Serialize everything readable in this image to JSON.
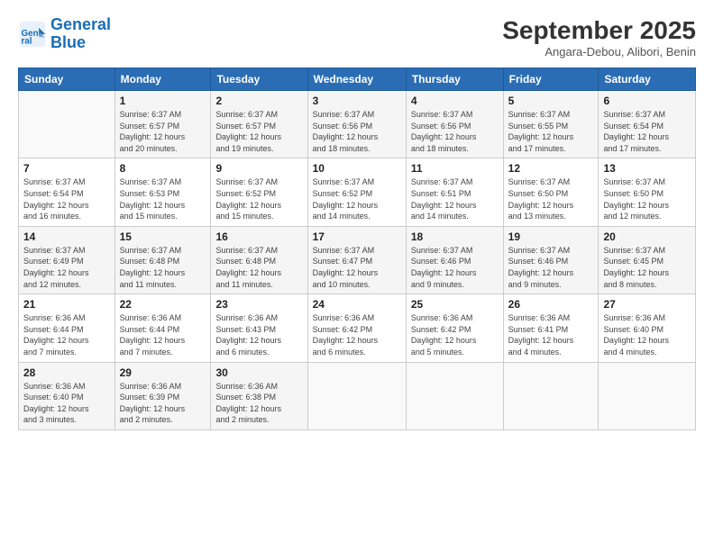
{
  "header": {
    "logo_line1": "General",
    "logo_line2": "Blue",
    "month_year": "September 2025",
    "location": "Angara-Debou, Alibori, Benin"
  },
  "days_of_week": [
    "Sunday",
    "Monday",
    "Tuesday",
    "Wednesday",
    "Thursday",
    "Friday",
    "Saturday"
  ],
  "weeks": [
    [
      {
        "day": "",
        "info": ""
      },
      {
        "day": "1",
        "info": "Sunrise: 6:37 AM\nSunset: 6:57 PM\nDaylight: 12 hours\nand 20 minutes."
      },
      {
        "day": "2",
        "info": "Sunrise: 6:37 AM\nSunset: 6:57 PM\nDaylight: 12 hours\nand 19 minutes."
      },
      {
        "day": "3",
        "info": "Sunrise: 6:37 AM\nSunset: 6:56 PM\nDaylight: 12 hours\nand 18 minutes."
      },
      {
        "day": "4",
        "info": "Sunrise: 6:37 AM\nSunset: 6:56 PM\nDaylight: 12 hours\nand 18 minutes."
      },
      {
        "day": "5",
        "info": "Sunrise: 6:37 AM\nSunset: 6:55 PM\nDaylight: 12 hours\nand 17 minutes."
      },
      {
        "day": "6",
        "info": "Sunrise: 6:37 AM\nSunset: 6:54 PM\nDaylight: 12 hours\nand 17 minutes."
      }
    ],
    [
      {
        "day": "7",
        "info": "Sunrise: 6:37 AM\nSunset: 6:54 PM\nDaylight: 12 hours\nand 16 minutes."
      },
      {
        "day": "8",
        "info": "Sunrise: 6:37 AM\nSunset: 6:53 PM\nDaylight: 12 hours\nand 15 minutes."
      },
      {
        "day": "9",
        "info": "Sunrise: 6:37 AM\nSunset: 6:52 PM\nDaylight: 12 hours\nand 15 minutes."
      },
      {
        "day": "10",
        "info": "Sunrise: 6:37 AM\nSunset: 6:52 PM\nDaylight: 12 hours\nand 14 minutes."
      },
      {
        "day": "11",
        "info": "Sunrise: 6:37 AM\nSunset: 6:51 PM\nDaylight: 12 hours\nand 14 minutes."
      },
      {
        "day": "12",
        "info": "Sunrise: 6:37 AM\nSunset: 6:50 PM\nDaylight: 12 hours\nand 13 minutes."
      },
      {
        "day": "13",
        "info": "Sunrise: 6:37 AM\nSunset: 6:50 PM\nDaylight: 12 hours\nand 12 minutes."
      }
    ],
    [
      {
        "day": "14",
        "info": "Sunrise: 6:37 AM\nSunset: 6:49 PM\nDaylight: 12 hours\nand 12 minutes."
      },
      {
        "day": "15",
        "info": "Sunrise: 6:37 AM\nSunset: 6:48 PM\nDaylight: 12 hours\nand 11 minutes."
      },
      {
        "day": "16",
        "info": "Sunrise: 6:37 AM\nSunset: 6:48 PM\nDaylight: 12 hours\nand 11 minutes."
      },
      {
        "day": "17",
        "info": "Sunrise: 6:37 AM\nSunset: 6:47 PM\nDaylight: 12 hours\nand 10 minutes."
      },
      {
        "day": "18",
        "info": "Sunrise: 6:37 AM\nSunset: 6:46 PM\nDaylight: 12 hours\nand 9 minutes."
      },
      {
        "day": "19",
        "info": "Sunrise: 6:37 AM\nSunset: 6:46 PM\nDaylight: 12 hours\nand 9 minutes."
      },
      {
        "day": "20",
        "info": "Sunrise: 6:37 AM\nSunset: 6:45 PM\nDaylight: 12 hours\nand 8 minutes."
      }
    ],
    [
      {
        "day": "21",
        "info": "Sunrise: 6:36 AM\nSunset: 6:44 PM\nDaylight: 12 hours\nand 7 minutes."
      },
      {
        "day": "22",
        "info": "Sunrise: 6:36 AM\nSunset: 6:44 PM\nDaylight: 12 hours\nand 7 minutes."
      },
      {
        "day": "23",
        "info": "Sunrise: 6:36 AM\nSunset: 6:43 PM\nDaylight: 12 hours\nand 6 minutes."
      },
      {
        "day": "24",
        "info": "Sunrise: 6:36 AM\nSunset: 6:42 PM\nDaylight: 12 hours\nand 6 minutes."
      },
      {
        "day": "25",
        "info": "Sunrise: 6:36 AM\nSunset: 6:42 PM\nDaylight: 12 hours\nand 5 minutes."
      },
      {
        "day": "26",
        "info": "Sunrise: 6:36 AM\nSunset: 6:41 PM\nDaylight: 12 hours\nand 4 minutes."
      },
      {
        "day": "27",
        "info": "Sunrise: 6:36 AM\nSunset: 6:40 PM\nDaylight: 12 hours\nand 4 minutes."
      }
    ],
    [
      {
        "day": "28",
        "info": "Sunrise: 6:36 AM\nSunset: 6:40 PM\nDaylight: 12 hours\nand 3 minutes."
      },
      {
        "day": "29",
        "info": "Sunrise: 6:36 AM\nSunset: 6:39 PM\nDaylight: 12 hours\nand 2 minutes."
      },
      {
        "day": "30",
        "info": "Sunrise: 6:36 AM\nSunset: 6:38 PM\nDaylight: 12 hours\nand 2 minutes."
      },
      {
        "day": "",
        "info": ""
      },
      {
        "day": "",
        "info": ""
      },
      {
        "day": "",
        "info": ""
      },
      {
        "day": "",
        "info": ""
      }
    ]
  ]
}
